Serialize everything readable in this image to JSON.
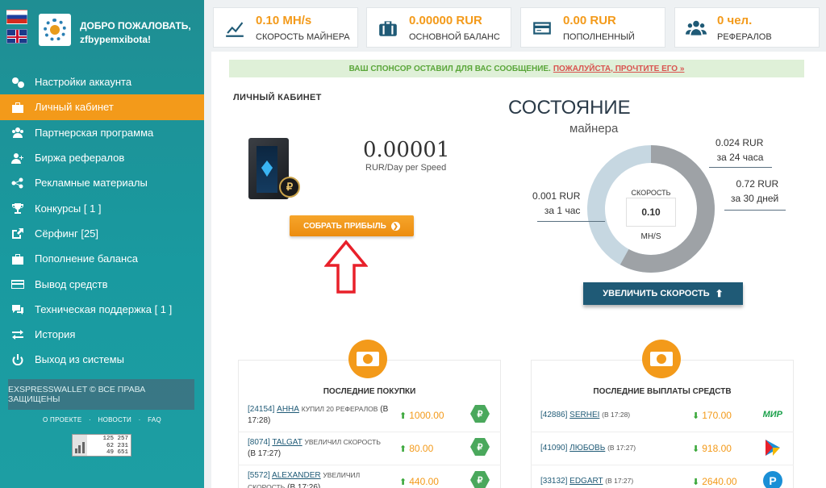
{
  "sidebar": {
    "welcome_line1": "ДОБРО ПОЖАЛОВАТЬ,",
    "welcome_line2": "zfbypemxibota!",
    "items": [
      {
        "label": "Настройки аккаунта",
        "icon": "gears-icon"
      },
      {
        "label": "Личный кабинет",
        "icon": "briefcase-icon",
        "active": true
      },
      {
        "label": "Партнерская программа",
        "icon": "users-icon"
      },
      {
        "label": "Биржа рефералов",
        "icon": "user-plus-icon"
      },
      {
        "label": "Рекламные материалы",
        "icon": "share-icon"
      },
      {
        "label": "Конкурсы [ 1 ]",
        "icon": "trophy-icon"
      },
      {
        "label": "Сёрфинг [25]",
        "icon": "external-link-icon"
      },
      {
        "label": "Пополнение баланса",
        "icon": "briefcase-icon"
      },
      {
        "label": "Вывод средств",
        "icon": "credit-card-icon"
      },
      {
        "label": "Техническая поддержка [ 1 ]",
        "icon": "chat-icon"
      },
      {
        "label": "История",
        "icon": "exchange-icon"
      },
      {
        "label": "Выход из системы",
        "icon": "power-icon"
      }
    ],
    "copyright": "EXSPRESSWALLET © ВСЕ ПРАВА ЗАЩИЩЕНЫ",
    "footer_links": [
      "О ПРОЕКТЕ",
      "·",
      "НОВОСТИ",
      "·",
      "FAQ"
    ],
    "counter": [
      "125 257",
      "62 231",
      "49 651"
    ]
  },
  "stats": [
    {
      "value": "0.10 MH/s",
      "label": "Скорость майнера",
      "icon": "chart-line-icon"
    },
    {
      "value": "0.00000 RUR",
      "label": "Основной баланс",
      "icon": "suitcase-icon"
    },
    {
      "value": "0.00 RUR",
      "label": "Пополненный",
      "icon": "credit-card-icon"
    },
    {
      "value": "0 чел.",
      "label": "Рефералов",
      "icon": "users-icon"
    }
  ],
  "sponsor": {
    "text": "ВАШ СПОНСОР ОСТАВИЛ ДЛЯ ВАС СООБЩЕНИЕ.",
    "link": "ПОЖАЛУЙСТА, ПРОЧТИТЕ ЕГО »"
  },
  "cabinet": {
    "title": "ЛИЧНЫЙ КАБИНЕТ",
    "profit_value": "0.00001",
    "profit_unit": "RUR/Day per Speed",
    "collect_label": "Собрать прибыль",
    "coin_symbol": "₽"
  },
  "state": {
    "title": "Состояние",
    "subtitle": "майнера",
    "speed_label": "Скорость",
    "speed_value": "0.10",
    "speed_unit": "MH/S",
    "fill_fraction": 0.58,
    "labels": {
      "day_value": "0.024 RUR",
      "day_period": "за 24 часа",
      "month_value": "0.72 RUR",
      "month_period": "за 30 дней",
      "hour_value": "0.001 RUR",
      "hour_period": "за 1 час"
    },
    "increase_label": "Увеличить скорость"
  },
  "purchases": {
    "title": "ПОСЛЕДНИЕ ПОКУПКИ",
    "rows": [
      {
        "id": "[24154]",
        "name": "АННА",
        "action": "КУПИЛ 20 РЕФЕРАЛОВ",
        "time": "(В 17:28)",
        "amount": "1000.00"
      },
      {
        "id": "[8074]",
        "name": "TALGAT",
        "action": "УВЕЛИЧИЛ СКОРОСТЬ",
        "time": "(В 17:27)",
        "amount": "80.00"
      },
      {
        "id": "[5572]",
        "name": "ALEXANDER",
        "action": "УВЕЛИЧИЛ СКОРОСТЬ",
        "time": "(В 17:26)",
        "amount": "440.00"
      }
    ]
  },
  "payouts": {
    "title": "ПОСЛЕДНИЕ ВЫПЛАТЫ СРЕДСТВ",
    "rows": [
      {
        "id": "[42886]",
        "name": "SERHEI",
        "time": "(В 17:28)",
        "amount": "170.00",
        "method": "mir"
      },
      {
        "id": "[41090]",
        "name": "ЛЮБОВЬ",
        "time": "(В 17:27)",
        "amount": "918.00",
        "method": "triangle"
      },
      {
        "id": "[33132]",
        "name": "EDGART",
        "time": "(В 17:27)",
        "amount": "2640.00",
        "method": "p"
      }
    ],
    "mir_label": "МИР",
    "p_label": "P"
  },
  "colors": {
    "accent": "#f39a1a",
    "teal": "#1f8e93",
    "navy": "#1f5a76",
    "green": "#4aa85c"
  }
}
